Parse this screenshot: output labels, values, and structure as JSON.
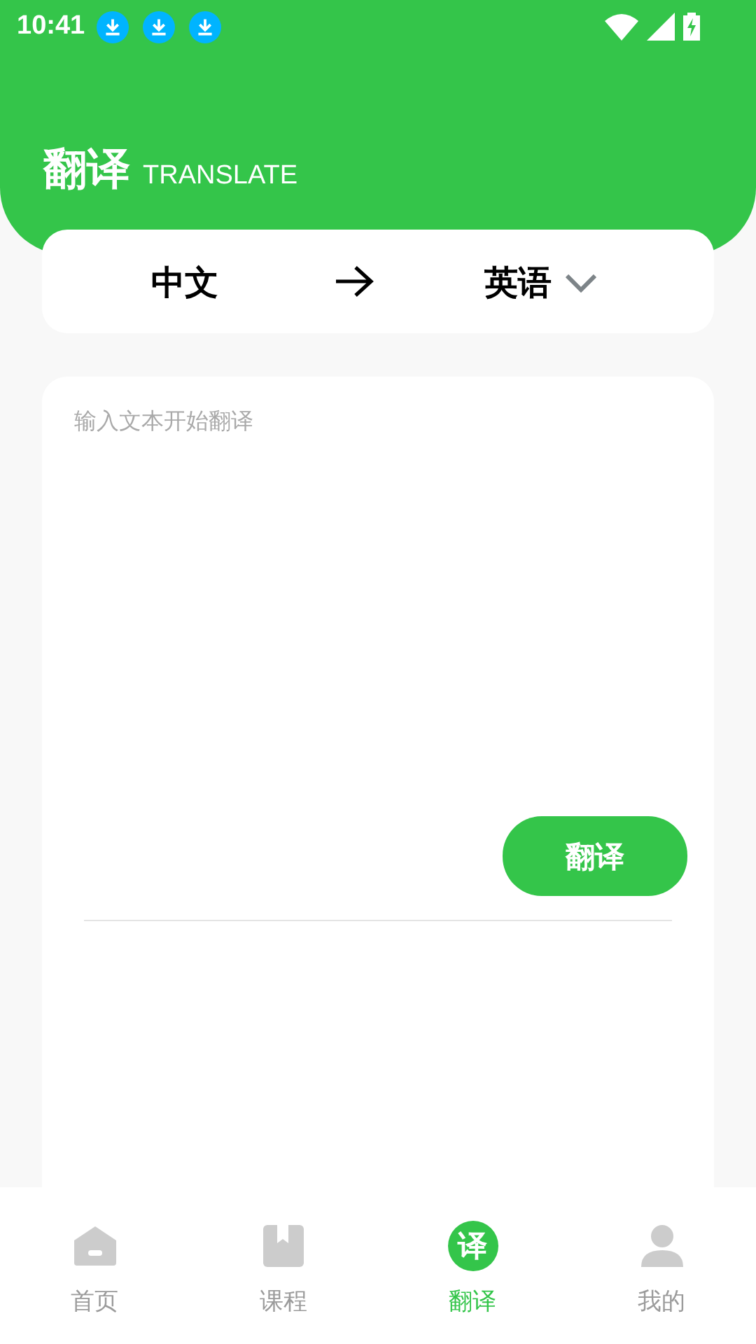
{
  "status_bar": {
    "time": "10:41",
    "notifications": [
      {
        "kind": "download"
      },
      {
        "kind": "download"
      },
      {
        "kind": "download"
      }
    ]
  },
  "header": {
    "title": "翻译",
    "subtitle": "TRANSLATE"
  },
  "language_bar": {
    "source": "中文",
    "target": "英语"
  },
  "input": {
    "placeholder": "输入文本开始翻译"
  },
  "translate_button": "翻译",
  "tabs": [
    {
      "label": "首页",
      "kind": "home",
      "selected": false
    },
    {
      "label": "课程",
      "kind": "course",
      "selected": false
    },
    {
      "label": "翻译",
      "kind": "translate",
      "icon_text": "译",
      "selected": true
    },
    {
      "label": "我的",
      "kind": "profile",
      "selected": false
    }
  ]
}
